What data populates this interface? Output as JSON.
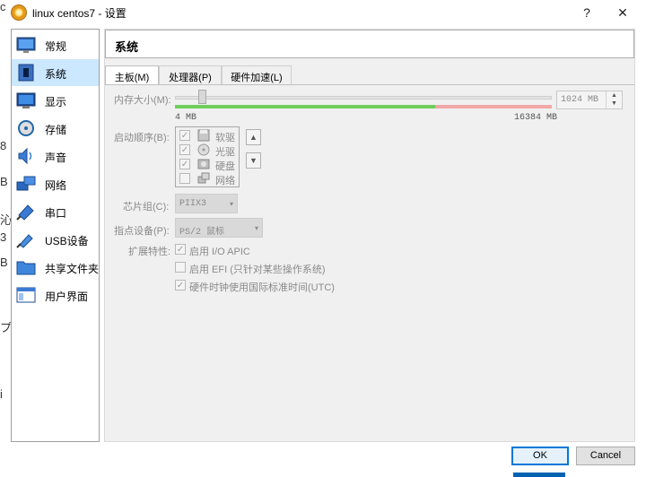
{
  "window": {
    "title": "linux centos7 - 设置",
    "help_btn": "?",
    "close_btn": "✕"
  },
  "sidebar": {
    "items": [
      {
        "label": "常规",
        "icon": "general-icon"
      },
      {
        "label": "系统",
        "icon": "system-icon",
        "selected": true
      },
      {
        "label": "显示",
        "icon": "display-icon"
      },
      {
        "label": "存储",
        "icon": "storage-icon"
      },
      {
        "label": "声音",
        "icon": "audio-icon"
      },
      {
        "label": "网络",
        "icon": "network-icon"
      },
      {
        "label": "串口",
        "icon": "serial-port-icon"
      },
      {
        "label": "USB设备",
        "icon": "usb-icon"
      },
      {
        "label": "共享文件夹",
        "icon": "shared-folder-icon"
      },
      {
        "label": "用户界面",
        "icon": "user-interface-icon"
      }
    ]
  },
  "main": {
    "section_title": "系统",
    "tabs": [
      "主板(M)",
      "处理器(P)",
      "硬件加速(L)"
    ],
    "memory": {
      "label": "内存大小(M):",
      "value": "1024 MB",
      "min_label": "4 MB",
      "max_label": "16384 MB",
      "level_fraction": 0.0625
    },
    "boot": {
      "label": "启动顺序(B):",
      "devices": [
        {
          "name": "软驱",
          "checked": true,
          "icon": "floppy-icon"
        },
        {
          "name": "光驱",
          "checked": true,
          "icon": "optical-drive-icon"
        },
        {
          "name": "硬盘",
          "checked": true,
          "icon": "hard-disk-icon"
        },
        {
          "name": "网络",
          "checked": false,
          "icon": "network-boot-icon"
        }
      ],
      "up_glyph": "▲",
      "down_glyph": "▼"
    },
    "chipset": {
      "label": "芯片组(C):",
      "value": "PIIX3"
    },
    "pointing": {
      "label": "指点设备(P):",
      "value": "PS/2 鼠标"
    },
    "extended": {
      "label": "扩展特性:",
      "options": [
        {
          "text": "启用 I/O APIC",
          "checked": true
        },
        {
          "text": "启用 EFI (只针对某些操作系统)",
          "checked": false
        },
        {
          "text": "硬件时钟使用国际标准时间(UTC)",
          "checked": true
        }
      ]
    }
  },
  "buttons": {
    "ok": "OK",
    "cancel": "Cancel"
  },
  "background_glyphs": [
    "c",
    "8",
    "B",
    "沁",
    "3",
    "B",
    "プ",
    "i"
  ],
  "colors": {
    "selected_bg": "#cce8ff",
    "accent": "#0078d7",
    "range_ok": "#6ecf5a",
    "range_warn": "#f3a7a7"
  }
}
